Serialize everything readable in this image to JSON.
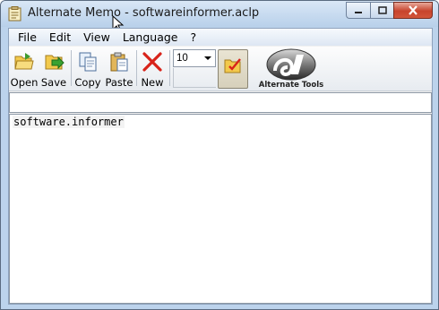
{
  "window": {
    "title": "Alternate Memo - softwareinformer.aclp"
  },
  "menu": {
    "items": [
      {
        "label": "File"
      },
      {
        "label": "Edit"
      },
      {
        "label": "View"
      },
      {
        "label": "Language"
      },
      {
        "label": "?"
      }
    ]
  },
  "toolbar": {
    "open_label": "Open",
    "save_label": "Save",
    "copy_label": "Copy",
    "paste_label": "Paste",
    "new_label": "New",
    "font_size": "10",
    "logo_text": "Alternate Tools"
  },
  "editor": {
    "content": "software.informer"
  },
  "colors": {
    "title_bar": "#c4d8ee",
    "close_button": "#c7432c",
    "new_icon": "#d8231a"
  }
}
